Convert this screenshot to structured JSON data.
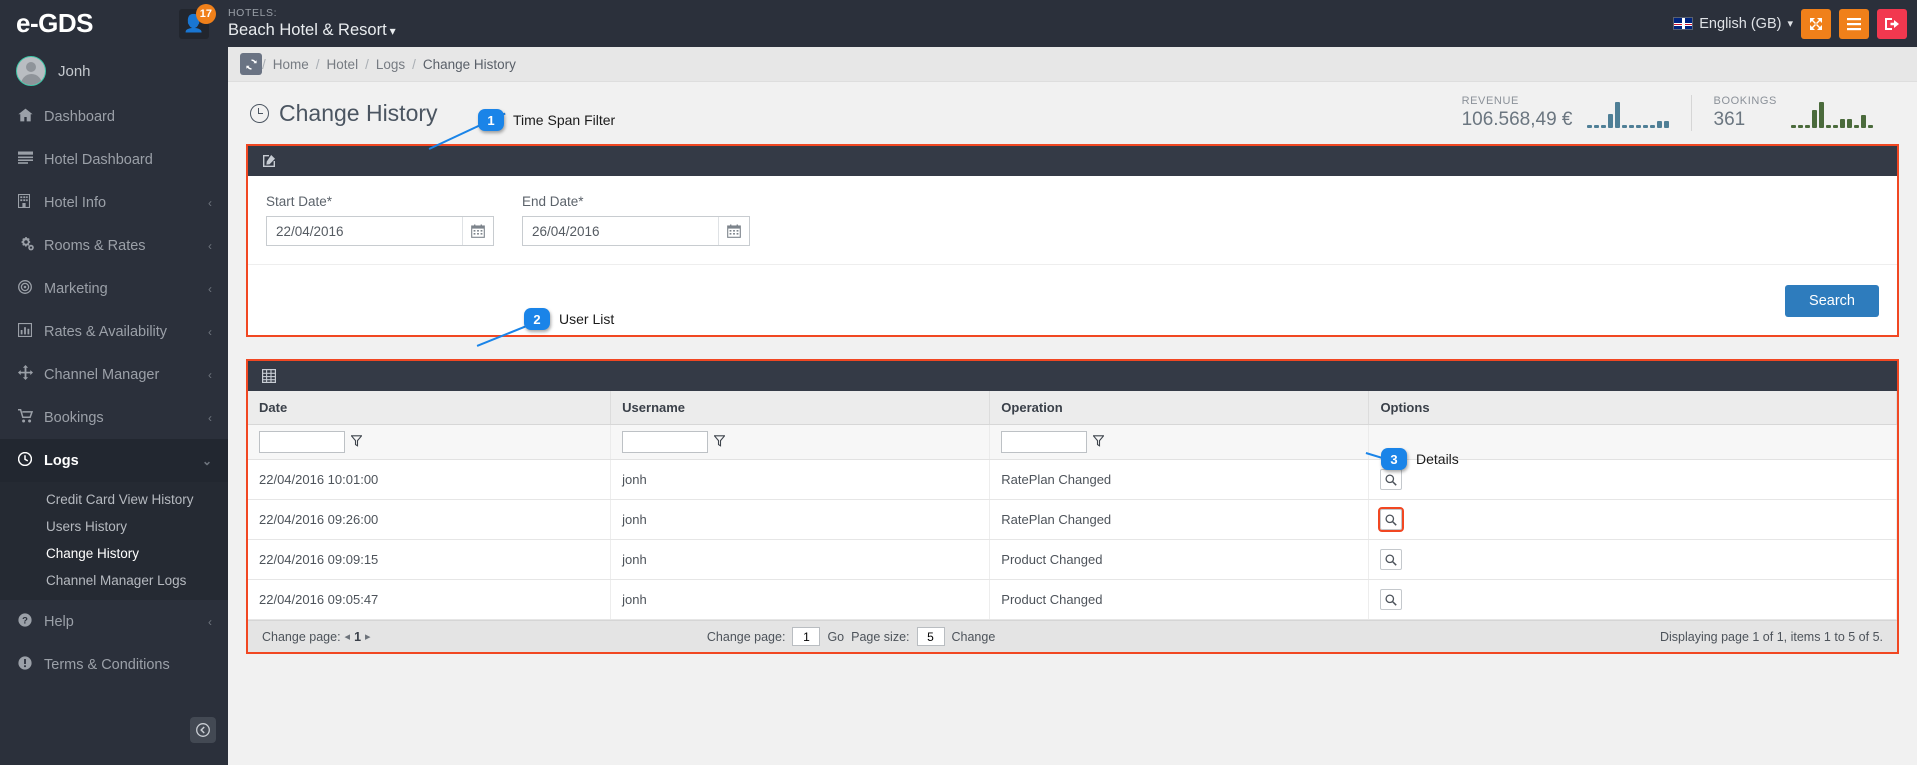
{
  "topbar": {
    "brand": "e-GDS",
    "messages_icon": "user-message-icon",
    "messages_badge": "17",
    "hotels_label": "HOTELS:",
    "hotel_name": "Beach Hotel & Resort",
    "hotel_caret": "⌄",
    "language": "English (GB)",
    "language_caret": "⌄",
    "btn_fullscreen": "✥",
    "btn_menu": "☰",
    "btn_logout": "⭢"
  },
  "sidebar": {
    "user": "Jonh",
    "items": [
      {
        "label": "Dashboard",
        "icon": "⌂",
        "icon_name": "home-icon",
        "chevron": "",
        "active": false
      },
      {
        "label": "Hotel Dashboard",
        "icon": "☰",
        "icon_name": "list-icon",
        "chevron": "",
        "active": false
      },
      {
        "label": "Hotel Info",
        "icon": "▤",
        "icon_name": "building-icon",
        "chevron": "‹",
        "active": false
      },
      {
        "label": "Rooms & Rates",
        "icon": "⚙",
        "icon_name": "cogs-icon",
        "chevron": "‹",
        "active": false
      },
      {
        "label": "Marketing",
        "icon": "◎",
        "icon_name": "bullseye-icon",
        "chevron": "‹",
        "active": false
      },
      {
        "label": "Rates & Availability",
        "icon": "Ὄa",
        "icon_name": "bar-chart-icon",
        "chevron": "‹",
        "active": false
      },
      {
        "label": "Channel Manager",
        "icon": "✥",
        "icon_name": "arrows-icon",
        "chevron": "‹",
        "active": false
      },
      {
        "label": "Bookings",
        "icon": "Ὥ2",
        "icon_name": "cart-icon",
        "chevron": "‹",
        "active": false
      },
      {
        "label": "Logs",
        "icon": "◔",
        "icon_name": "clock-icon",
        "chevron": "⌄",
        "active": true
      }
    ],
    "sub_items": [
      {
        "label": "Credit Card View History",
        "active": false
      },
      {
        "label": "Users History",
        "active": false
      },
      {
        "label": "Change History",
        "active": true
      },
      {
        "label": "Channel Manager Logs",
        "active": false
      }
    ],
    "bottom_items": [
      {
        "label": "Help",
        "icon": "❓",
        "icon_name": "question-circle-icon",
        "chevron": "‹"
      },
      {
        "label": "Terms & Conditions",
        "icon": "❗",
        "icon_name": "exclamation-circle-icon",
        "chevron": ""
      }
    ],
    "collapse_icon": "←",
    "collapse_name": "collapse-sidebar-button"
  },
  "breadcrumb": {
    "refresh_icon": "↻",
    "sep": "/",
    "items": [
      "Home",
      "Hotel",
      "Logs",
      "Change History"
    ]
  },
  "page": {
    "title": "Change History",
    "title_icon": "clock-icon"
  },
  "stats": [
    {
      "label": "REVENUE",
      "value": "106.568,49 €",
      "color": "#4f7f96",
      "spark": [
        3,
        3,
        3,
        14,
        26,
        3,
        3,
        3,
        3,
        3,
        7,
        7
      ]
    },
    {
      "label": "BOOKINGS",
      "value": "361",
      "color": "#4b6b3c",
      "spark": [
        3,
        3,
        3,
        18,
        26,
        3,
        3,
        9,
        9,
        3,
        13,
        3
      ]
    }
  ],
  "filter_card": {
    "head_icon": "✎",
    "head_icon_name": "edit-icon",
    "start_label": "Start Date*",
    "start_value": "22/04/2016",
    "start_placeholder": "dd/mm/yyyy",
    "end_label": "End Date*",
    "end_value": "26/04/2016",
    "end_placeholder": "dd/mm/yyyy",
    "calendar_icon": "Ὄ5",
    "search_button": "Search"
  },
  "table_card": {
    "head_icon": "▦",
    "head_icon_name": "table-icon",
    "columns": [
      "Date",
      "Username",
      "Operation",
      "Options"
    ],
    "filter_values": [
      "",
      "",
      ""
    ],
    "filter_placeholder": "",
    "funnel_icon": "∇",
    "rows": [
      {
        "date": "22/04/2016 10:01:00",
        "username": "jonh",
        "operation": "RatePlan Changed",
        "options_icon": "ὐd",
        "highlight": false
      },
      {
        "date": "22/04/2016 09:26:00",
        "username": "jonh",
        "operation": "RatePlan Changed",
        "options_icon": "ὐd",
        "highlight": true
      },
      {
        "date": "22/04/2016 09:09:15",
        "username": "jonh",
        "operation": "Product Changed",
        "options_icon": "ὐd",
        "highlight": false
      },
      {
        "date": "22/04/2016 09:05:47",
        "username": "jonh",
        "operation": "Product Changed",
        "options_icon": "ὐd",
        "highlight": false
      }
    ],
    "footer": {
      "change_page_label": "Change page:",
      "prev_arrow": "◂",
      "page_number": "1",
      "next_arrow": "▸",
      "change_page_label2": "Change page:",
      "page_input": "1",
      "go_label": "Go",
      "page_size_label": "Page size:",
      "page_size_input": "5",
      "change_label": "Change",
      "display_info": "Displaying page 1 of 1, items 1 to 5 of 5."
    }
  },
  "annotations": [
    {
      "number": "1",
      "text": "Time Span Filter"
    },
    {
      "number": "2",
      "text": "User List"
    },
    {
      "number": "3",
      "text": "Details"
    }
  ],
  "colors": {
    "accent_orange": "#f14722",
    "brand_dark": "#2b303b",
    "primary_blue": "#2e7cbd",
    "badge_blue": "#1a84e8",
    "badge_orange": "#f0801a",
    "logout_red": "#f2384f"
  }
}
